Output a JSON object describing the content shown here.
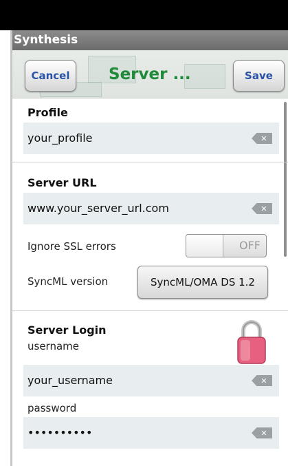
{
  "app": {
    "title": "Synthesis"
  },
  "header": {
    "cancel_label": "Cancel",
    "title": "Server ...",
    "save_label": "Save"
  },
  "profile": {
    "section_title": "Profile",
    "value": "your_profile"
  },
  "server": {
    "section_title": "Server URL",
    "url_value": "www.your_server_url.com",
    "ignore_ssl_label": "Ignore SSL errors",
    "ignore_ssl_state": "OFF",
    "syncml_label": "SyncML version",
    "syncml_value": "SyncML/OMA DS 1.2"
  },
  "login": {
    "section_title": "Server Login",
    "username_label": "username",
    "username_value": "your_username",
    "password_label": "password",
    "password_value": "••••••••••"
  },
  "colors": {
    "title_green": "#1f8a3a",
    "button_text_blue": "#2a52a8",
    "field_bg": "#e8edf0",
    "lock_pink": "#e8607f"
  },
  "icons": {
    "clear": "backspace-clear-icon",
    "lock": "padlock-icon"
  }
}
